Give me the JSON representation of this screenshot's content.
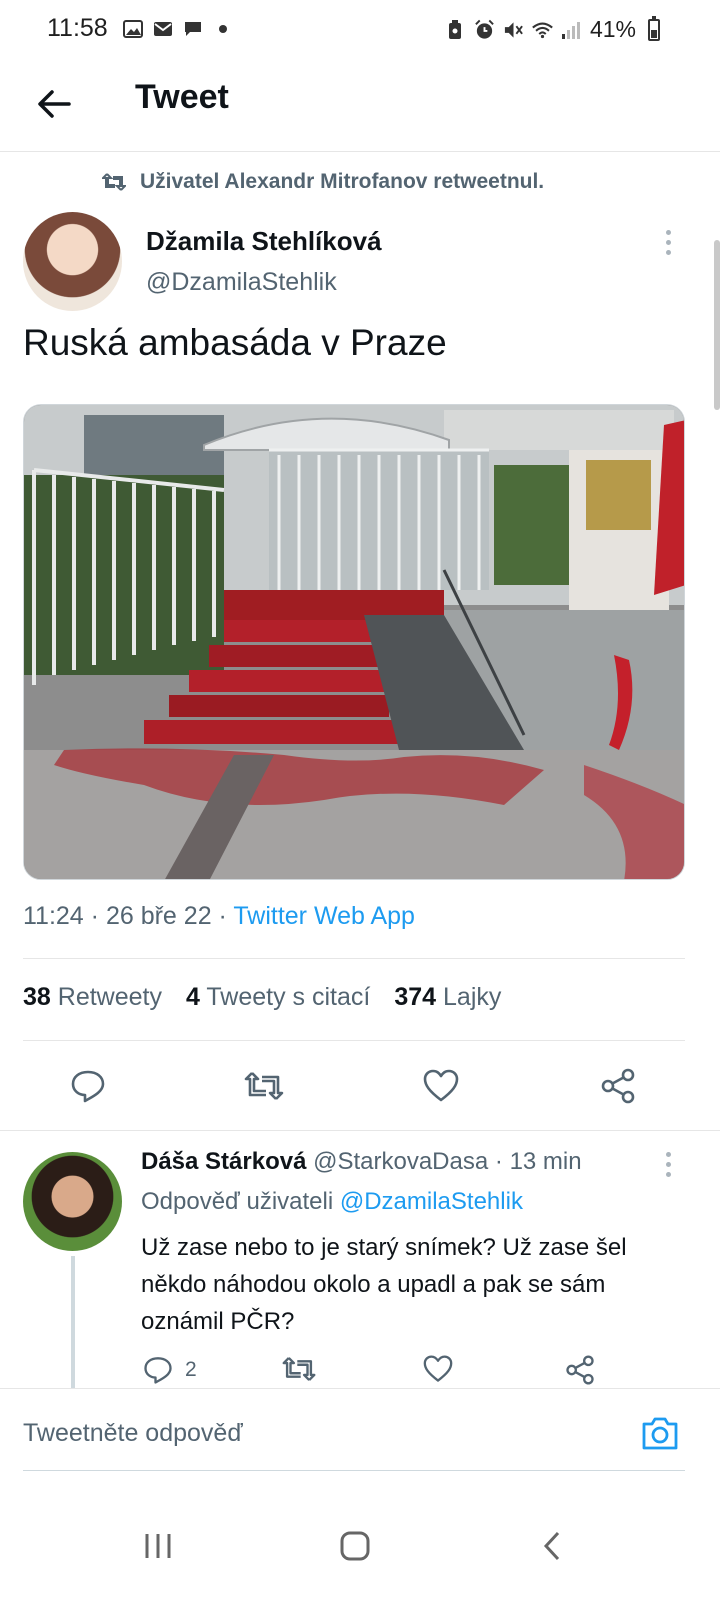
{
  "status_bar": {
    "time": "11:58",
    "battery_percent": "41%",
    "left_icons": [
      "image-icon",
      "mail-icon",
      "chat-icon",
      "dot-icon"
    ],
    "right_icons": [
      "lock-battery-icon",
      "alarm-icon",
      "mute-icon",
      "wifi-icon",
      "signal-icon",
      "battery-icon"
    ]
  },
  "header": {
    "title": "Tweet"
  },
  "retweet_banner": {
    "text": "Uživatel Alexandr Mitrofanov retweetnul."
  },
  "tweet": {
    "author_name": "Džamila Stehlíková",
    "author_handle": "@DzamilaStehlik",
    "text": "Ruská ambasáda v Praze",
    "time": "11:24",
    "date": "26 bře 22",
    "source": "Twitter Web App",
    "stats": {
      "retweets_count": "38",
      "retweets_label": "Retweety",
      "quotes_count": "4",
      "quotes_label": "Tweety s citací",
      "likes_count": "374",
      "likes_label": "Lajky"
    }
  },
  "reply": {
    "name": "Dáša Stárková",
    "handle": "@StarkovaDasa",
    "time": "13 min",
    "replying_to_label": "Odpověď uživateli",
    "replying_to_handle": "@DzamilaStehlik",
    "text": "Už zase nebo to je starý snímek? Už zase šel někdo náhodou okolo a upadl a pak se sám oznámil PČR?",
    "reply_count": "2"
  },
  "compose": {
    "placeholder": "Tweetněte odpověď"
  },
  "colors": {
    "link": "#1d9bf0",
    "secondary_text": "#536471",
    "primary_text": "#0f1419",
    "paint_red": "#b3202a"
  }
}
